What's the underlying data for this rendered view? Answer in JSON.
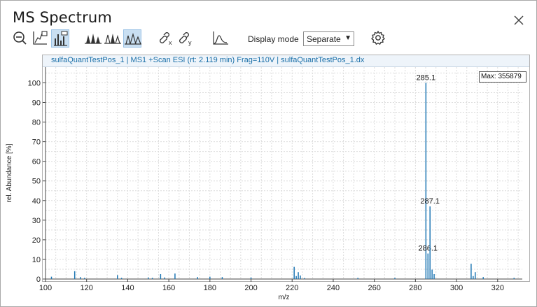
{
  "window": {
    "title": "MS Spectrum"
  },
  "toolbar": {
    "buttons": [
      {
        "name": "zoom-out-button",
        "icon": "zoom-out-icon"
      },
      {
        "name": "axis-scale-button",
        "icon": "axis-chart-icon"
      },
      {
        "name": "bar-spectrum-button",
        "icon": "bar-spectrum-icon",
        "active": true
      },
      {
        "name": "overlay-peaks-button",
        "icon": "filled-peaks-icon"
      },
      {
        "name": "stacked-peaks-button",
        "icon": "outline-peaks-icon"
      },
      {
        "name": "separate-peaks-button",
        "icon": "separate-peaks-icon",
        "active": true
      },
      {
        "name": "link-x-button",
        "icon": "link-x-icon"
      },
      {
        "name": "link-y-button",
        "icon": "link-y-icon"
      },
      {
        "name": "profile-button",
        "icon": "profile-curve-icon"
      },
      {
        "name": "settings-button",
        "icon": "gear-icon"
      }
    ],
    "display_mode_label": "Display mode",
    "display_mode_value": "Separate"
  },
  "plot": {
    "header": "sulfaQuantTestPos_1 | MS1  +Scan ESI (rt: 2.119 min) Frag=110V | sulfaQuantTestPos_1.dx",
    "max_label": "Max: 355879"
  },
  "colors": {
    "accent": "#1a6fa8",
    "peak": "#1f77b4",
    "active_button": "#c9dff2"
  },
  "chart_data": {
    "type": "bar",
    "xlabel": "m/z",
    "ylabel": "rel. Abundance [%]",
    "xlim": [
      100,
      332
    ],
    "ylim": [
      0,
      108
    ],
    "xticks": [
      100,
      120,
      140,
      160,
      180,
      200,
      220,
      240,
      260,
      280,
      300,
      320
    ],
    "yticks": [
      0,
      10,
      20,
      30,
      40,
      50,
      60,
      70,
      80,
      90,
      100
    ],
    "grid": true,
    "peaks": [
      {
        "mz": 102.9,
        "rel": 1.2
      },
      {
        "mz": 114.2,
        "rel": 4.0
      },
      {
        "mz": 117.0,
        "rel": 1.0
      },
      {
        "mz": 119.0,
        "rel": 0.6
      },
      {
        "mz": 135.0,
        "rel": 2.0
      },
      {
        "mz": 137.0,
        "rel": 0.6
      },
      {
        "mz": 150.0,
        "rel": 0.8
      },
      {
        "mz": 152.0,
        "rel": 0.6
      },
      {
        "mz": 156.0,
        "rel": 2.5
      },
      {
        "mz": 158.0,
        "rel": 0.8
      },
      {
        "mz": 163.0,
        "rel": 2.8
      },
      {
        "mz": 174.0,
        "rel": 1.0
      },
      {
        "mz": 180.0,
        "rel": 1.2
      },
      {
        "mz": 186.0,
        "rel": 1.0
      },
      {
        "mz": 200.0,
        "rel": 0.8
      },
      {
        "mz": 221.0,
        "rel": 6.2
      },
      {
        "mz": 222.0,
        "rel": 1.5
      },
      {
        "mz": 223.0,
        "rel": 3.5
      },
      {
        "mz": 224.0,
        "rel": 1.8
      },
      {
        "mz": 226.0,
        "rel": 0.5
      },
      {
        "mz": 252.0,
        "rel": 0.6
      },
      {
        "mz": 270.0,
        "rel": 0.6
      },
      {
        "mz": 285.1,
        "rel": 100.0,
        "label": "285.1"
      },
      {
        "mz": 286.1,
        "rel": 13.0,
        "label": "286.1"
      },
      {
        "mz": 287.1,
        "rel": 37.0,
        "label": "287.1"
      },
      {
        "mz": 288.1,
        "rel": 4.8
      },
      {
        "mz": 289.1,
        "rel": 2.5
      },
      {
        "mz": 307.1,
        "rel": 7.8
      },
      {
        "mz": 308.1,
        "rel": 1.5
      },
      {
        "mz": 309.1,
        "rel": 3.5
      },
      {
        "mz": 313.0,
        "rel": 1.0
      },
      {
        "mz": 328.0,
        "rel": 0.6
      }
    ]
  }
}
